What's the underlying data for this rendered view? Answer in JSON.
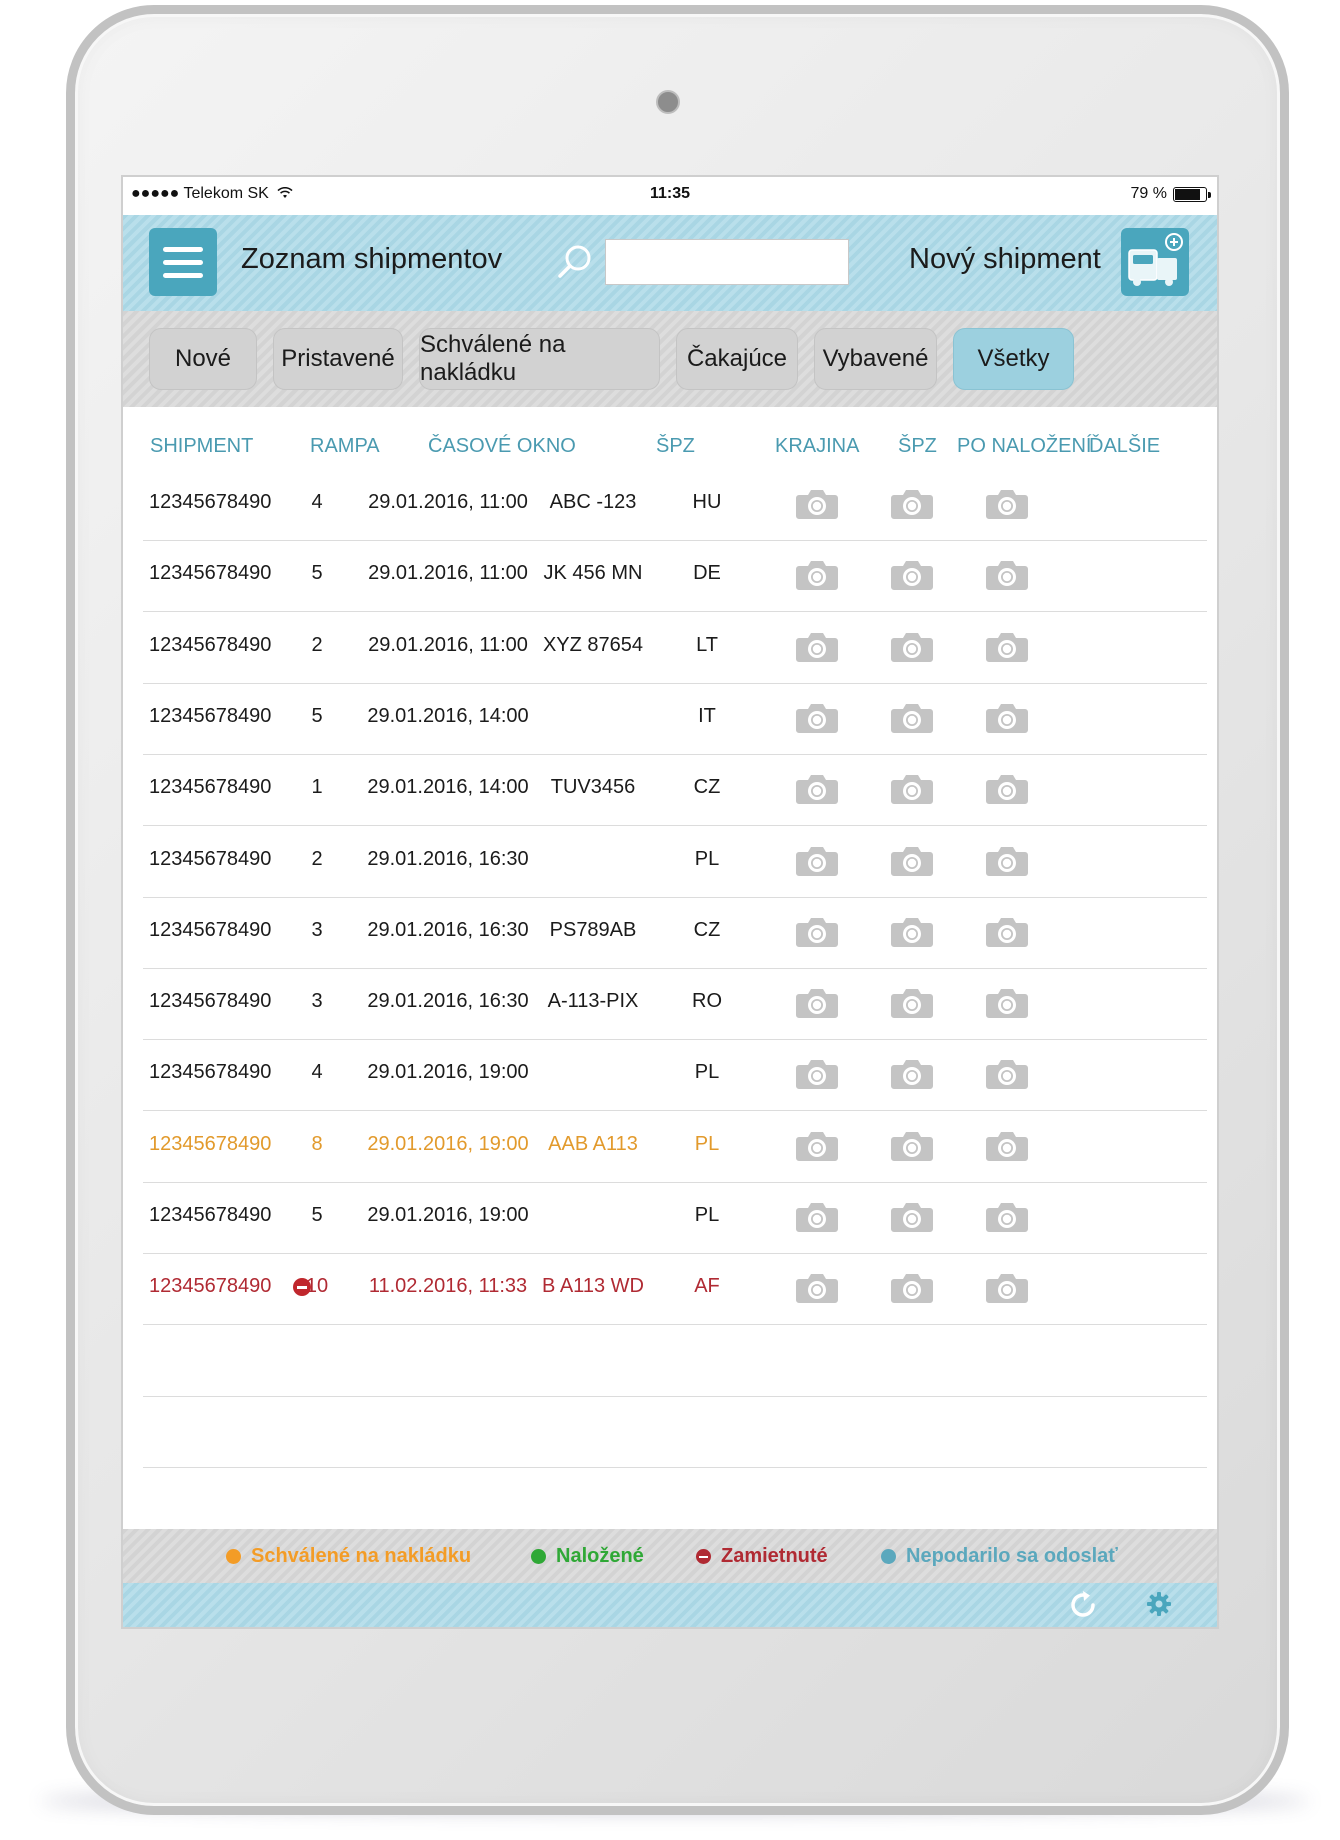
{
  "status_bar": {
    "carrier": "●●●●● Telekom SK",
    "time": "11:35",
    "battery": "79 %"
  },
  "header": {
    "title": "Zoznam shipmentov",
    "search_value": "",
    "new_label": "Nový shipment"
  },
  "tabs": [
    {
      "label": "Nové",
      "active": false
    },
    {
      "label": "Pristavené",
      "active": false
    },
    {
      "label": "Schválené na nakládku",
      "active": false
    },
    {
      "label": "Čakajúce",
      "active": false
    },
    {
      "label": "Vybavené",
      "active": false
    },
    {
      "label": "Všetky",
      "active": true
    }
  ],
  "table": {
    "columns": [
      "SHIPMENT",
      "RAMPA",
      "ČASOVÉ OKNO",
      "ŠPZ",
      "KRAJINA",
      "ŠPZ",
      "PO NALOŽENÍ",
      "ĎALŠIE"
    ],
    "rows": [
      {
        "shipment": "12345678490",
        "rampa": "4",
        "okno": "29.01.2016, 11:00",
        "spz": "ABC -123",
        "krajina": "HU",
        "status": "normal"
      },
      {
        "shipment": "12345678490",
        "rampa": "5",
        "okno": "29.01.2016, 11:00",
        "spz": "JK 456 MN",
        "krajina": "DE",
        "status": "normal"
      },
      {
        "shipment": "12345678490",
        "rampa": "2",
        "okno": "29.01.2016, 11:00",
        "spz": "XYZ 87654",
        "krajina": "LT",
        "status": "normal"
      },
      {
        "shipment": "12345678490",
        "rampa": "5",
        "okno": "29.01.2016, 14:00",
        "spz": "",
        "krajina": "IT",
        "status": "normal"
      },
      {
        "shipment": "12345678490",
        "rampa": "1",
        "okno": "29.01.2016, 14:00",
        "spz": "TUV3456",
        "krajina": "CZ",
        "status": "normal"
      },
      {
        "shipment": "12345678490",
        "rampa": "2",
        "okno": "29.01.2016, 16:30",
        "spz": "",
        "krajina": "PL",
        "status": "normal"
      },
      {
        "shipment": "12345678490",
        "rampa": "3",
        "okno": "29.01.2016, 16:30",
        "spz": "PS789AB",
        "krajina": "CZ",
        "status": "normal"
      },
      {
        "shipment": "12345678490",
        "rampa": "3",
        "okno": "29.01.2016, 16:30",
        "spz": "A-113-PIX",
        "krajina": "RO",
        "status": "normal"
      },
      {
        "shipment": "12345678490",
        "rampa": "4",
        "okno": "29.01.2016, 19:00",
        "spz": "",
        "krajina": "PL",
        "status": "normal"
      },
      {
        "shipment": "12345678490",
        "rampa": "8",
        "okno": "29.01.2016, 19:00",
        "spz": "AAB A113",
        "krajina": "PL",
        "status": "approved"
      },
      {
        "shipment": "12345678490",
        "rampa": "5",
        "okno": "29.01.2016, 19:00",
        "spz": "",
        "krajina": "PL",
        "status": "normal"
      },
      {
        "shipment": "12345678490",
        "rampa": "10",
        "okno": "11.02.2016, 11:33",
        "spz": "B A113 WD",
        "krajina": "AF",
        "status": "rejected"
      }
    ],
    "empty_rows": 3
  },
  "legend": [
    {
      "label": "Schválené na nakládku",
      "color": "#f39c26",
      "minus": false
    },
    {
      "label": "Naložené",
      "color": "#2fa836",
      "minus": false
    },
    {
      "label": "Zamietnuté",
      "color": "#b02a33",
      "minus": true
    },
    {
      "label": "Nepodarilo sa odoslať",
      "color": "#5ba8bd",
      "minus": false
    }
  ],
  "colors": {
    "accent": "#4aa6bd",
    "header_text": "#4a9ab0",
    "approved": "#e29a2c",
    "rejected": "#b02a33",
    "camera": "#c4c4c4"
  },
  "icons": {
    "menu": "hamburger-icon",
    "search": "search-icon",
    "new_shipment": "truck-add-icon",
    "photo": "camera-icon",
    "refresh": "refresh-icon",
    "settings": "gear-icon"
  }
}
